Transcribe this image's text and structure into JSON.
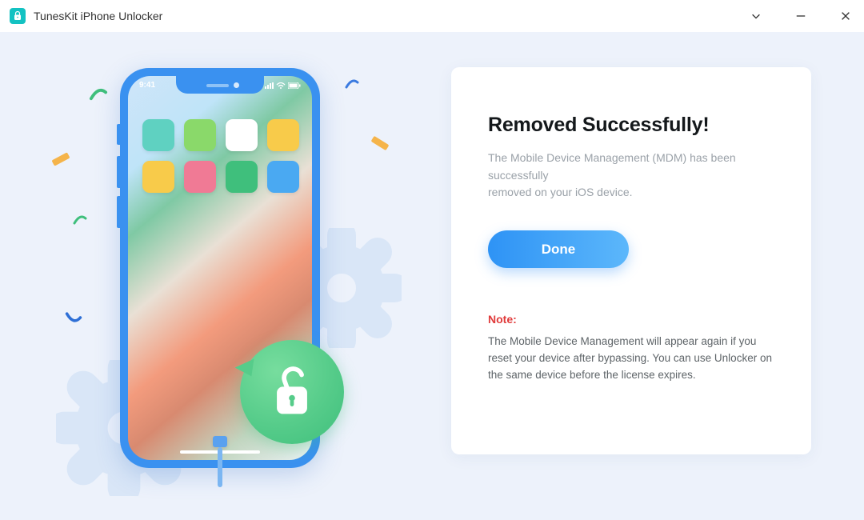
{
  "titlebar": {
    "app_name": "TunesKit iPhone Unlocker"
  },
  "illustration": {
    "status_time": "9:41",
    "app_colors": [
      "#5fd1c1",
      "#8ad96a",
      "#ffffff",
      "#f8cb4a",
      "#f8cb4a",
      "#f07a95",
      "#3fbf7c",
      "#4aa9f2"
    ]
  },
  "panel": {
    "heading": "Removed Successfully!",
    "description": "The Mobile Device Management (MDM) has been successfully\nremoved on your iOS device.",
    "done_label": "Done",
    "note_label": "Note:",
    "note_body": "The Mobile Device Management will appear again if you reset your device after bypassing. You can use Unlocker on the same device before the license expires."
  }
}
